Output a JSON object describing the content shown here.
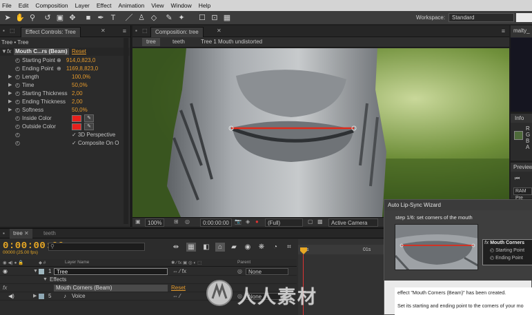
{
  "menubar": [
    "File",
    "Edit",
    "Composition",
    "Layer",
    "Effect",
    "Animation",
    "View",
    "Window",
    "Help"
  ],
  "workspace": {
    "label": "Workspace:",
    "value": "Standard"
  },
  "effect_controls": {
    "tab_label": "Effect Controls: Tree",
    "breadcrumb": "Tree • Tree",
    "effect_name": "Mouth C...rs (Beam)",
    "reset_label": "Reset",
    "properties": [
      {
        "label": "Starting Point",
        "value": "914,0,823,0"
      },
      {
        "label": "Ending Point",
        "value": "1169,8,823,0"
      },
      {
        "label": "Length",
        "value": "100,0%"
      },
      {
        "label": "Time",
        "value": "50,0%"
      },
      {
        "label": "Starting Thickness",
        "value": "2,00"
      },
      {
        "label": "Ending Thickness",
        "value": "2,00"
      },
      {
        "label": "Softness",
        "value": "50,0%"
      },
      {
        "label": "Inside Color",
        "value": ""
      },
      {
        "label": "Outside Color",
        "value": ""
      }
    ],
    "checkboxes": [
      "3D Perspective",
      "Composite On O"
    ],
    "swatch_color": "#e8201c"
  },
  "composition": {
    "tab_label": "Composition: tree",
    "crumbs": [
      "tree",
      "teeth",
      "Tree 1 Mouth undistorted"
    ],
    "footer": {
      "zoom": "100%",
      "time": "0:00:00:00",
      "resolution": "(Full)",
      "camera": "Active Camera"
    }
  },
  "right": {
    "top_label": "malty_",
    "info_tab": "Info",
    "info_letters": [
      "R",
      "G",
      "B",
      "A"
    ],
    "preview_tab": "Preview",
    "ram_label": "RAM Pre"
  },
  "timeline": {
    "tabs": [
      "tree",
      "teeth"
    ],
    "timecode": "0:00:00:00",
    "fps": "00000 (25.00 fps)",
    "headers": {
      "layer_name": "Layer Name",
      "parent": "Parent"
    },
    "layers": [
      {
        "num": "1",
        "name": "Tree",
        "parent": "None"
      },
      {
        "num": "",
        "name": "Effects",
        "parent": ""
      },
      {
        "num": "",
        "name": "Mouth Corners (Beam)",
        "parent": "",
        "reset": "Reset"
      },
      {
        "num": "5",
        "name": "Voice",
        "parent": "None"
      }
    ],
    "ruler": [
      "0s",
      "01s"
    ]
  },
  "wizard": {
    "title": "Auto Lip-Sync Wizard",
    "step": "step 1/6: set corners of the mouth",
    "fx_items": [
      "Mouth Corners",
      "Starting Point",
      "Ending Point"
    ],
    "message_line1": "effect \"Mouth Corners (Beam)\" has been created.",
    "message_line2": "Set its starting and ending point to the corners of your mo"
  },
  "watermark": {
    "text": "人人素材"
  }
}
